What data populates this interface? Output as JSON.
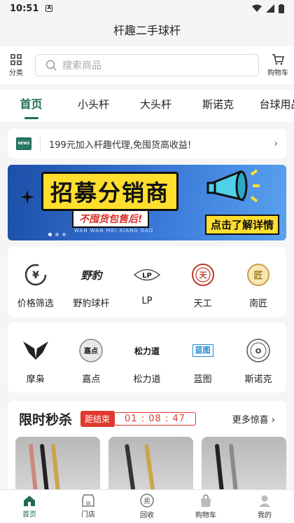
{
  "status": {
    "time": "10:51"
  },
  "title": "杆趣二手球杆",
  "left_btn": "分类",
  "search_placeholder": "搜索商品",
  "cart_btn": "购物车",
  "tabs": [
    "首页",
    "小头杆",
    "大头杆",
    "斯诺克",
    "台球用品"
  ],
  "notice": {
    "badge": "NEWS",
    "text": "199元加入杆趣代理,免囤货高收益!"
  },
  "banner": {
    "title": "招募分销商",
    "sub": "不囤货包售后!",
    "pinyin": "WAN WAN MEI XIANG DAO",
    "cta": "点击了解详情"
  },
  "brands_row1": [
    {
      "label": "价格筛选",
      "icon": "price-filter-icon",
      "mark": "¥"
    },
    {
      "label": "野豹球杆",
      "icon": "yebao-logo",
      "mark": "野豹"
    },
    {
      "label": "LP",
      "icon": "lp-logo",
      "mark": "LP"
    },
    {
      "label": "天工",
      "icon": "tiangong-logo",
      "mark": "天"
    },
    {
      "label": "南匠",
      "icon": "nanjiang-logo",
      "mark": "匠"
    }
  ],
  "brands_row2": [
    {
      "label": "摩枭",
      "icon": "moxiao-logo",
      "mark": "◆"
    },
    {
      "label": "嘉点",
      "icon": "jiadian-logo",
      "mark": "嘉点"
    },
    {
      "label": "松力道",
      "icon": "songlidao-logo",
      "mark": "松力道"
    },
    {
      "label": "蓝图",
      "icon": "lantu-logo",
      "mark": "蓝图"
    },
    {
      "label": "斯诺克",
      "icon": "snooker-logo",
      "mark": "O"
    }
  ],
  "flash": {
    "title": "限时秒杀",
    "end_label": "距结束",
    "timer": "01 : 08 : 47",
    "more": "更多惊喜"
  },
  "tabbar": [
    "首页",
    "门店",
    "回收",
    "购物车",
    "我的"
  ],
  "colors": {
    "accent": "#1f6b57",
    "flash_red": "#e03a2f",
    "banner_blue": "#2b6cd0",
    "banner_yellow": "#ffde2e"
  }
}
